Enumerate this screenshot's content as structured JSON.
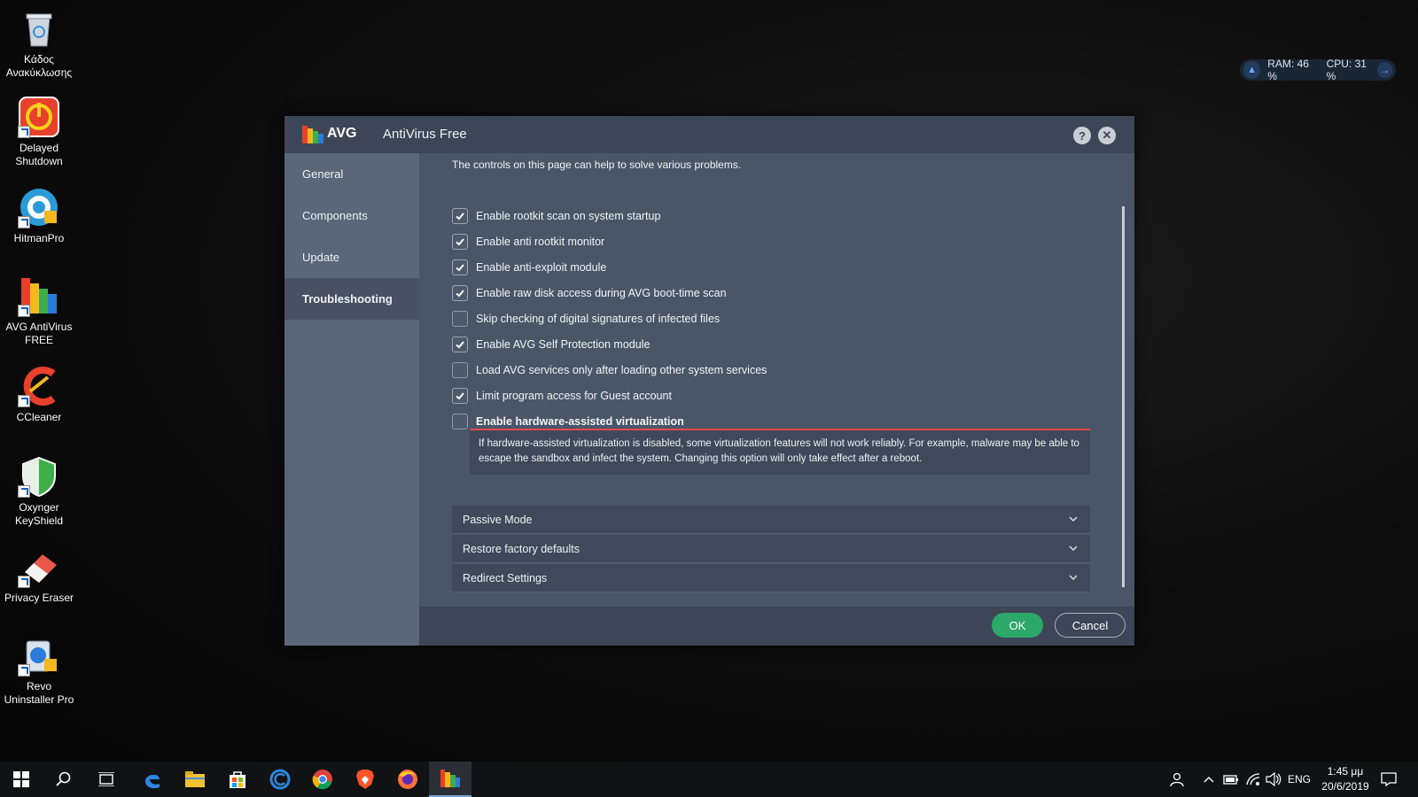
{
  "desktop": {
    "icons": [
      {
        "label": "Κάδος Ανακύκλωσης",
        "icon": "recycle-bin-icon"
      },
      {
        "label": "Delayed Shutdown",
        "icon": "power-icon"
      },
      {
        "label": "HitmanPro",
        "icon": "hitmanpro-icon"
      },
      {
        "label": "AVG AntiVirus FREE",
        "icon": "avg-icon"
      },
      {
        "label": "CCleaner",
        "icon": "ccleaner-icon"
      },
      {
        "label": "Oxynger KeyShield",
        "icon": "shield-icon"
      },
      {
        "label": "Privacy Eraser",
        "icon": "eraser-icon"
      },
      {
        "label": "Revo Uninstaller Pro",
        "icon": "revo-icon"
      }
    ]
  },
  "perf_widget": {
    "ram": "RAM: 46 %",
    "cpu": "CPU: 31 %"
  },
  "window": {
    "brand": "AVG",
    "title": "AntiVirus Free",
    "help_label": "?",
    "close_label": "✕",
    "sidebar": [
      {
        "label": "General",
        "active": false
      },
      {
        "label": "Components",
        "active": false
      },
      {
        "label": "Update",
        "active": false
      },
      {
        "label": "Troubleshooting",
        "active": true
      }
    ],
    "intro": "The controls on this page can help to solve various problems.",
    "options": [
      {
        "label": "Enable rootkit scan on system startup",
        "checked": true
      },
      {
        "label": "Enable anti rootkit monitor",
        "checked": true
      },
      {
        "label": "Enable anti-exploit module",
        "checked": true
      },
      {
        "label": "Enable raw disk access during AVG boot-time scan",
        "checked": true
      },
      {
        "label": "Skip checking of digital signatures of infected files",
        "checked": false
      },
      {
        "label": "Enable AVG Self Protection module",
        "checked": true
      },
      {
        "label": "Load AVG services only after loading other system services",
        "checked": false
      },
      {
        "label": "Limit program access for Guest account",
        "checked": true
      },
      {
        "label": "Enable hardware-assisted virtualization",
        "checked": false
      }
    ],
    "hw_description": "If hardware-assisted virtualization is disabled, some virtualization features will not work reliably. For example, malware may be able to escape the sandbox and infect the system. Changing this option will only take effect after a reboot.",
    "accordions": [
      {
        "label": "Passive Mode"
      },
      {
        "label": "Restore factory defaults"
      },
      {
        "label": "Redirect Settings"
      }
    ],
    "ok_label": "OK",
    "cancel_label": "Cancel"
  },
  "taskbar": {
    "apps": [
      "start-icon",
      "search-icon",
      "task-view-icon",
      "edge-icon",
      "file-explorer-icon",
      "store-icon",
      "ccleaner-browser-icon",
      "chrome-icon",
      "brave-icon",
      "firefox-icon",
      "avg-taskbar-icon"
    ],
    "language": "ENG",
    "time": "1:45 μμ",
    "date": "20/6/2019"
  },
  "colors": {
    "accent_ok": "#2ca86a",
    "warning_line": "#e5484d",
    "window_bg": "#4a5566"
  }
}
